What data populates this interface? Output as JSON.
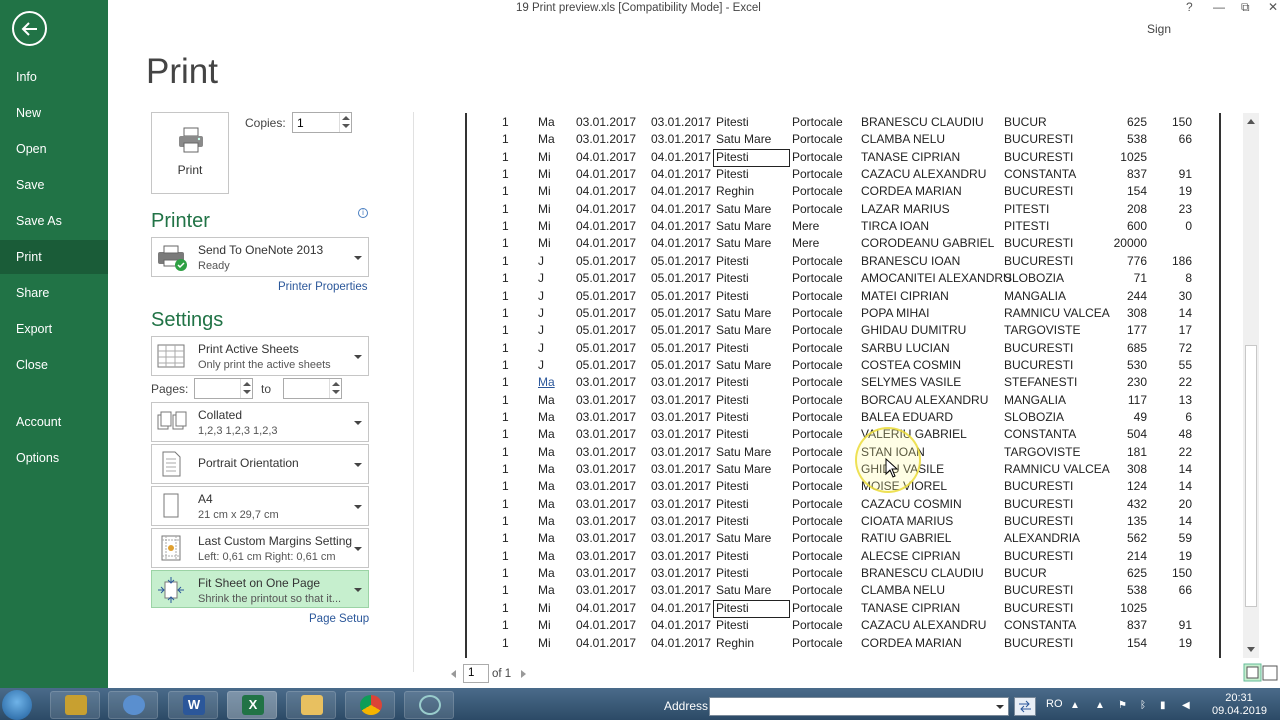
{
  "window": {
    "title": "19 Print preview.xls  [Compatibility Mode] - Excel",
    "help": "?",
    "minimize": "—",
    "restore": "⧉",
    "close": "✕",
    "sign_in": "Sign"
  },
  "nav": {
    "items": [
      {
        "label": "Info"
      },
      {
        "label": "New"
      },
      {
        "label": "Open"
      },
      {
        "label": "Save"
      },
      {
        "label": "Save As"
      },
      {
        "label": "Print",
        "active": true
      },
      {
        "label": "Share"
      },
      {
        "label": "Export"
      },
      {
        "label": "Close"
      },
      {
        "label": "Account"
      },
      {
        "label": "Options"
      }
    ]
  },
  "print": {
    "heading": "Print",
    "button_label": "Print",
    "copies_label": "Copies:",
    "copies_value": "1"
  },
  "printer": {
    "section_title": "Printer",
    "name": "Send To OneNote 2013",
    "status": "Ready",
    "properties_link": "Printer Properties"
  },
  "settings": {
    "section_title": "Settings",
    "sheets": {
      "title": "Print Active Sheets",
      "subtitle": "Only print the active sheets"
    },
    "pages_label": "Pages:",
    "to_label": "to",
    "collation": {
      "title": "Collated",
      "subtitle": "1,2,3    1,2,3    1,2,3"
    },
    "orientation": {
      "title": "Portrait Orientation"
    },
    "paper": {
      "title": "A4",
      "subtitle": "21 cm x 29,7 cm"
    },
    "margins": {
      "title": "Last Custom Margins Setting",
      "subtitle": "Left:  0,61 cm    Right:  0,61 cm"
    },
    "scaling": {
      "title": "Fit Sheet on One Page",
      "subtitle": "Shrink the printout so that it..."
    },
    "page_setup_link": "Page Setup"
  },
  "preview": {
    "rows": [
      [
        "1",
        "Ma",
        "03.01.2017",
        "03.01.2017",
        "Pitesti",
        "Portocale",
        "BRANESCU CLAUDIU",
        "BUCUR",
        "625",
        "150"
      ],
      [
        "1",
        "Ma",
        "03.01.2017",
        "03.01.2017",
        "Satu Mare",
        "Portocale",
        "CLAMBA NELU",
        "BUCURESTI",
        "538",
        "66"
      ],
      [
        "1",
        "Mi",
        "04.01.2017",
        "04.01.2017",
        "Pitesti",
        "Portocale",
        "TANASE CIPRIAN",
        "BUCURESTI",
        "1025",
        ""
      ],
      [
        "1",
        "Mi",
        "04.01.2017",
        "04.01.2017",
        "Pitesti",
        "Portocale",
        "CAZACU ALEXANDRU",
        "CONSTANTA",
        "837",
        "91"
      ],
      [
        "1",
        "Mi",
        "04.01.2017",
        "04.01.2017",
        "Reghin",
        "Portocale",
        "CORDEA MARIAN",
        "BUCURESTI",
        "154",
        "19"
      ],
      [
        "1",
        "Mi",
        "04.01.2017",
        "04.01.2017",
        "Satu Mare",
        "Portocale",
        "LAZAR MARIUS",
        "PITESTI",
        "208",
        "23"
      ],
      [
        "1",
        "Mi",
        "04.01.2017",
        "04.01.2017",
        "Satu Mare",
        "Mere",
        "TIRCA IOAN",
        "PITESTI",
        "600",
        "0"
      ],
      [
        "1",
        "Mi",
        "04.01.2017",
        "04.01.2017",
        "Satu Mare",
        "Mere",
        "CORODEANU GABRIEL",
        "BUCURESTI",
        "20000",
        ""
      ],
      [
        "1",
        "J",
        "05.01.2017",
        "05.01.2017",
        "Pitesti",
        "Portocale",
        "BRANESCU IOAN",
        "BUCURESTI",
        "776",
        "186"
      ],
      [
        "1",
        "J",
        "05.01.2017",
        "05.01.2017",
        "Pitesti",
        "Portocale",
        "AMOCANITEI ALEXANDRU",
        "SLOBOZIA",
        "71",
        "8"
      ],
      [
        "1",
        "J",
        "05.01.2017",
        "05.01.2017",
        "Pitesti",
        "Portocale",
        "MATEI CIPRIAN",
        "MANGALIA",
        "244",
        "30"
      ],
      [
        "1",
        "J",
        "05.01.2017",
        "05.01.2017",
        "Satu Mare",
        "Portocale",
        "POPA MIHAI",
        "RAMNICU VALCEA",
        "308",
        "14"
      ],
      [
        "1",
        "J",
        "05.01.2017",
        "05.01.2017",
        "Satu Mare",
        "Portocale",
        "GHIDAU DUMITRU",
        "TARGOVISTE",
        "177",
        "17"
      ],
      [
        "1",
        "J",
        "05.01.2017",
        "05.01.2017",
        "Pitesti",
        "Portocale",
        "SARBU LUCIAN",
        "BUCURESTI",
        "685",
        "72"
      ],
      [
        "1",
        "J",
        "05.01.2017",
        "05.01.2017",
        "Satu Mare",
        "Portocale",
        "COSTEA COSMIN",
        "BUCURESTI",
        "530",
        "55"
      ],
      [
        "1",
        "Ma",
        "03.01.2017",
        "03.01.2017",
        "Pitesti",
        "Portocale",
        "SELYMES VASILE",
        "STEFANESTI",
        "230",
        "22"
      ],
      [
        "1",
        "Ma",
        "03.01.2017",
        "03.01.2017",
        "Pitesti",
        "Portocale",
        "BORCAU ALEXANDRU",
        "MANGALIA",
        "117",
        "13"
      ],
      [
        "1",
        "Ma",
        "03.01.2017",
        "03.01.2017",
        "Pitesti",
        "Portocale",
        "BALEA EDUARD",
        "SLOBOZIA",
        "49",
        "6"
      ],
      [
        "1",
        "Ma",
        "03.01.2017",
        "03.01.2017",
        "Pitesti",
        "Portocale",
        "VALERIU GABRIEL",
        "CONSTANTA",
        "504",
        "48"
      ],
      [
        "1",
        "Ma",
        "03.01.2017",
        "03.01.2017",
        "Satu Mare",
        "Portocale",
        "STAN IOAN",
        "TARGOVISTE",
        "181",
        "22"
      ],
      [
        "1",
        "Ma",
        "03.01.2017",
        "03.01.2017",
        "Satu Mare",
        "Portocale",
        "GHIDU VASILE",
        "RAMNICU VALCEA",
        "308",
        "14"
      ],
      [
        "1",
        "Ma",
        "03.01.2017",
        "03.01.2017",
        "Pitesti",
        "Portocale",
        "MOISE VIOREL",
        "BUCURESTI",
        "124",
        "14"
      ],
      [
        "1",
        "Ma",
        "03.01.2017",
        "03.01.2017",
        "Pitesti",
        "Portocale",
        "CAZACU COSMIN",
        "BUCURESTI",
        "432",
        "20"
      ],
      [
        "1",
        "Ma",
        "03.01.2017",
        "03.01.2017",
        "Pitesti",
        "Portocale",
        "CIOATA MARIUS",
        "BUCURESTI",
        "135",
        "14"
      ],
      [
        "1",
        "Ma",
        "03.01.2017",
        "03.01.2017",
        "Satu Mare",
        "Portocale",
        "RATIU GABRIEL",
        "ALEXANDRIA",
        "562",
        "59"
      ],
      [
        "1",
        "Ma",
        "03.01.2017",
        "03.01.2017",
        "Pitesti",
        "Portocale",
        "ALECSE CIPRIAN",
        "BUCURESTI",
        "214",
        "19"
      ],
      [
        "1",
        "Ma",
        "03.01.2017",
        "03.01.2017",
        "Pitesti",
        "Portocale",
        "BRANESCU CLAUDIU",
        "BUCUR",
        "625",
        "150"
      ],
      [
        "1",
        "Ma",
        "03.01.2017",
        "03.01.2017",
        "Satu Mare",
        "Portocale",
        "CLAMBA NELU",
        "BUCURESTI",
        "538",
        "66"
      ],
      [
        "1",
        "Mi",
        "04.01.2017",
        "04.01.2017",
        "Pitesti",
        "Portocale",
        "TANASE CIPRIAN",
        "BUCURESTI",
        "1025",
        ""
      ],
      [
        "1",
        "Mi",
        "04.01.2017",
        "04.01.2017",
        "Pitesti",
        "Portocale",
        "CAZACU ALEXANDRU",
        "CONSTANTA",
        "837",
        "91"
      ],
      [
        "1",
        "Mi",
        "04.01.2017",
        "04.01.2017",
        "Reghin",
        "Portocale",
        "CORDEA MARIAN",
        "BUCURESTI",
        "154",
        "19"
      ]
    ],
    "boxed_rows": [
      2,
      28
    ],
    "highlighted_row": 15
  },
  "page_nav": {
    "current": "1",
    "of": "of 1"
  },
  "taskbar": {
    "address_label": "Address",
    "language": "RO",
    "time": "20:31",
    "date": "09.04.2019",
    "apps": [
      {
        "icon": "outlook-icon"
      },
      {
        "icon": "word-icon",
        "glyph": "W",
        "color": "#2b579a"
      },
      {
        "icon": "excel-icon",
        "glyph": "X",
        "color": "#217346"
      },
      {
        "icon": "explorer-icon"
      },
      {
        "icon": "chrome-icon"
      },
      {
        "icon": "media-icon"
      }
    ]
  },
  "colors": {
    "accent": "#217346",
    "selected_setting": "#c6efce",
    "link": "#2b579a"
  }
}
